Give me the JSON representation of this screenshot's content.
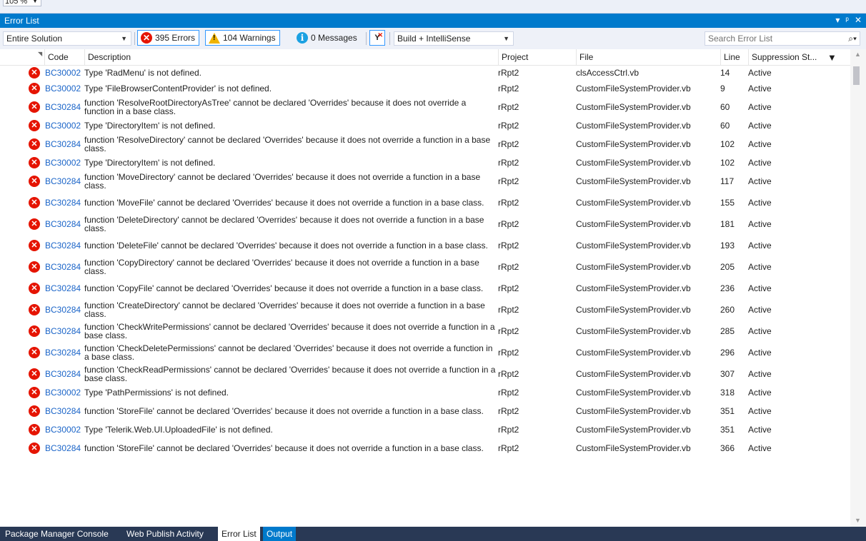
{
  "zoom": {
    "value": "105 %"
  },
  "window": {
    "title": "Error List"
  },
  "toolbar": {
    "scope": "Entire Solution",
    "errors": "395 Errors",
    "warnings": "104 Warnings",
    "messages": "0 Messages",
    "build_filter": "Build + IntelliSense",
    "search_placeholder": "Search Error List"
  },
  "columns": {
    "code": "Code",
    "description": "Description",
    "project": "Project",
    "file": "File",
    "line": "Line",
    "suppression": "Suppression St..."
  },
  "rows": [
    {
      "code": "BC30002",
      "desc": "Type 'RadMenu' is not defined.",
      "project": "rRpt2",
      "file": "clsAccessCtrl.vb",
      "line": "14",
      "supp": "Active"
    },
    {
      "code": "BC30002",
      "desc": "Type 'FileBrowserContentProvider' is not defined.",
      "project": "rRpt2",
      "file": "CustomFileSystemProvider.vb",
      "line": "9",
      "supp": "Active"
    },
    {
      "code": "BC30284",
      "desc": "function 'ResolveRootDirectoryAsTree' cannot be declared 'Overrides' because it does not override a function in a base class.",
      "project": "rRpt2",
      "file": "CustomFileSystemProvider.vb",
      "line": "60",
      "supp": "Active"
    },
    {
      "code": "BC30002",
      "desc": "Type 'DirectoryItem' is not defined.",
      "project": "rRpt2",
      "file": "CustomFileSystemProvider.vb",
      "line": "60",
      "supp": "Active"
    },
    {
      "code": "BC30284",
      "desc": "function 'ResolveDirectory' cannot be declared 'Overrides' because it does not override a function in a base class.",
      "project": "rRpt2",
      "file": "CustomFileSystemProvider.vb",
      "line": "102",
      "supp": "Active"
    },
    {
      "code": "BC30002",
      "desc": "Type 'DirectoryItem' is not defined.",
      "project": "rRpt2",
      "file": "CustomFileSystemProvider.vb",
      "line": "102",
      "supp": "Active"
    },
    {
      "code": "BC30284",
      "desc": "function 'MoveDirectory' cannot be declared 'Overrides' because it does not override a function in a base class.",
      "project": "rRpt2",
      "file": "CustomFileSystemProvider.vb",
      "line": "117",
      "supp": "Active"
    },
    {
      "code": "BC30284",
      "desc": "function 'MoveFile' cannot be declared 'Overrides' because it does not override a function in a base class.",
      "project": "rRpt2",
      "file": "CustomFileSystemProvider.vb",
      "line": "155",
      "supp": "Active"
    },
    {
      "code": "BC30284",
      "desc": "function 'DeleteDirectory' cannot be declared 'Overrides' because it does not override a function in a base class.",
      "project": "rRpt2",
      "file": "CustomFileSystemProvider.vb",
      "line": "181",
      "supp": "Active"
    },
    {
      "code": "BC30284",
      "desc": "function 'DeleteFile' cannot be declared 'Overrides' because it does not override a function in a base class.",
      "project": "rRpt2",
      "file": "CustomFileSystemProvider.vb",
      "line": "193",
      "supp": "Active"
    },
    {
      "code": "BC30284",
      "desc": "function 'CopyDirectory' cannot be declared 'Overrides' because it does not override a function in a base class.",
      "project": "rRpt2",
      "file": "CustomFileSystemProvider.vb",
      "line": "205",
      "supp": "Active"
    },
    {
      "code": "BC30284",
      "desc": "function 'CopyFile' cannot be declared 'Overrides' because it does not override a function in a base class.",
      "project": "rRpt2",
      "file": "CustomFileSystemProvider.vb",
      "line": "236",
      "supp": "Active"
    },
    {
      "code": "BC30284",
      "desc": "function 'CreateDirectory' cannot be declared 'Overrides' because it does not override a function in a base class.",
      "project": "rRpt2",
      "file": "CustomFileSystemProvider.vb",
      "line": "260",
      "supp": "Active"
    },
    {
      "code": "BC30284",
      "desc": "function 'CheckWritePermissions' cannot be declared 'Overrides' because it does not override a function in a base class.",
      "project": "rRpt2",
      "file": "CustomFileSystemProvider.vb",
      "line": "285",
      "supp": "Active"
    },
    {
      "code": "BC30284",
      "desc": "function 'CheckDeletePermissions' cannot be declared 'Overrides' because it does not override a function in a base class.",
      "project": "rRpt2",
      "file": "CustomFileSystemProvider.vb",
      "line": "296",
      "supp": "Active"
    },
    {
      "code": "BC30284",
      "desc": "function 'CheckReadPermissions' cannot be declared 'Overrides' because it does not override a function in a base class.",
      "project": "rRpt2",
      "file": "CustomFileSystemProvider.vb",
      "line": "307",
      "supp": "Active"
    },
    {
      "code": "BC30002",
      "desc": "Type 'PathPermissions' is not defined.",
      "project": "rRpt2",
      "file": "CustomFileSystemProvider.vb",
      "line": "318",
      "supp": "Active"
    },
    {
      "code": "BC30284",
      "desc": "function 'StoreFile' cannot be declared 'Overrides' because it does not override a function in a base class.",
      "project": "rRpt2",
      "file": "CustomFileSystemProvider.vb",
      "line": "351",
      "supp": "Active"
    },
    {
      "code": "BC30002",
      "desc": "Type 'Telerik.Web.UI.UploadedFile' is not defined.",
      "project": "rRpt2",
      "file": "CustomFileSystemProvider.vb",
      "line": "351",
      "supp": "Active"
    },
    {
      "code": "BC30284",
      "desc": "function 'StoreFile' cannot be declared 'Overrides' because it does not override a function in a base class.",
      "project": "rRpt2",
      "file": "CustomFileSystemProvider.vb",
      "line": "366",
      "supp": "Active"
    }
  ],
  "bottom_tabs": [
    "Package Manager Console",
    "Web Publish Activity",
    "Error List",
    "Output"
  ],
  "colors": {
    "accent": "#007acc",
    "error": "#e51400",
    "link": "#1a64c8",
    "warning": "#f0b400"
  }
}
